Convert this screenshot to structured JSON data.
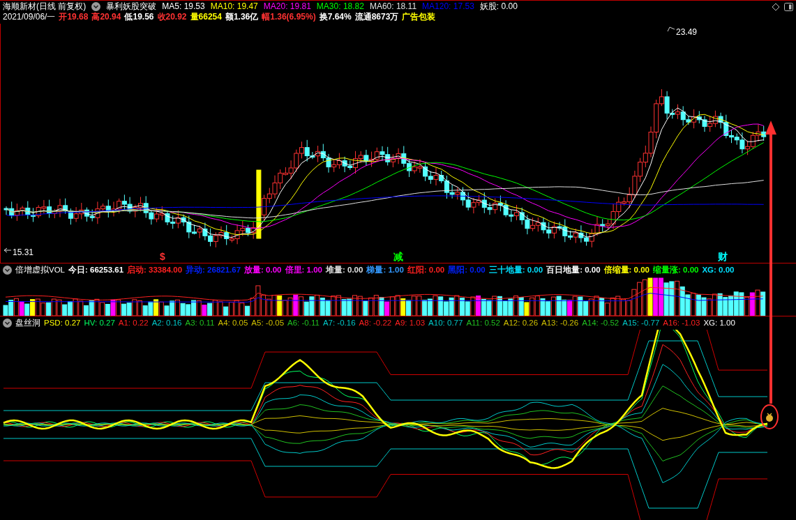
{
  "header": {
    "stock": "海顺新材(日线 前复权)",
    "formula": "暴利妖股突破",
    "ma": [
      {
        "label": "MA5:",
        "value": "19.53",
        "color": "#ffffff"
      },
      {
        "label": "MA10:",
        "value": "19.47",
        "color": "#ffff00"
      },
      {
        "label": "MA20:",
        "value": "19.81",
        "color": "#ff00ff"
      },
      {
        "label": "MA30:",
        "value": "18.82",
        "color": "#00ff00"
      },
      {
        "label": "MA60:",
        "value": "18.11",
        "color": "#e0e0e0"
      },
      {
        "label": "MA120:",
        "value": "17.53",
        "color": "#0000ff"
      },
      {
        "label": "妖股:",
        "value": "0.00",
        "color": "#ffffff"
      }
    ],
    "date": "2021/09/06/一",
    "quote": [
      {
        "text": "开19.68",
        "color": "#ff3232"
      },
      {
        "text": "高20.94",
        "color": "#ff3232"
      },
      {
        "text": "低19.56",
        "color": "#ffffff"
      },
      {
        "text": "收20.92",
        "color": "#ff3232"
      },
      {
        "text": "量66254",
        "color": "#ffff00"
      },
      {
        "text": "额1.36亿",
        "color": "#ffffff"
      },
      {
        "text": "幅1.36(6.95%)",
        "color": "#ff3232"
      },
      {
        "text": "换7.64%",
        "color": "#ffffff"
      },
      {
        "text": "流通8673万",
        "color": "#ffffff"
      },
      {
        "text": "广告包装",
        "color": "#ffff00"
      }
    ]
  },
  "price_chart": {
    "high_label": "23.49",
    "low_label": "15.31",
    "markers": [
      {
        "text": "$",
        "color": "#ff3232"
      },
      {
        "text": "减",
        "color": "#00ff00"
      },
      {
        "text": "财",
        "color": "#00ffff"
      }
    ]
  },
  "volume_panel": {
    "title": "倍增虚拟VOL",
    "items": [
      {
        "label": "今日:",
        "value": "66253.61",
        "color": "#ffffff"
      },
      {
        "label": "启动:",
        "value": "33384.00",
        "color": "#ff2020"
      },
      {
        "label": "异动:",
        "value": "26821.67",
        "color": "#0020ff"
      },
      {
        "label": "放量:",
        "value": "0.00",
        "color": "#ff00ff"
      },
      {
        "label": "倍里:",
        "value": "1.00",
        "color": "#ff00ff"
      },
      {
        "label": "堆量:",
        "value": "0.00",
        "color": "#e0e0e0"
      },
      {
        "label": "梯量:",
        "value": "1.00",
        "color": "#3399ff"
      },
      {
        "label": "红阳:",
        "value": "0.00",
        "color": "#ff2020"
      },
      {
        "label": "黑阳:",
        "value": "0.00",
        "color": "#0020ff"
      },
      {
        "label": "三十地量:",
        "value": "0.00",
        "color": "#00e0ff"
      },
      {
        "label": "百日地量:",
        "value": "0.00",
        "color": "#ffffff"
      },
      {
        "label": "倍缩量:",
        "value": "0.00",
        "color": "#ffff00"
      },
      {
        "label": "缩量涨:",
        "value": "0.00",
        "color": "#00ff00"
      },
      {
        "label": "XG:",
        "value": "0.00",
        "color": "#00e0ff"
      }
    ]
  },
  "oscillator_panel": {
    "title": "盘丝洞",
    "items": [
      {
        "label": "PSD:",
        "value": "0.27",
        "color": "#ffff00"
      },
      {
        "label": "HV:",
        "value": "0.27",
        "color": "#00ff60"
      },
      {
        "label": "A1:",
        "value": "0.22",
        "color": "#ff2020"
      },
      {
        "label": "A2:",
        "value": "0.16",
        "color": "#00c8c8"
      },
      {
        "label": "A3:",
        "value": "0.11",
        "color": "#20c020"
      },
      {
        "label": "A4:",
        "value": "0.05",
        "color": "#d0c000"
      },
      {
        "label": "A5:",
        "value": "-0.05",
        "color": "#d0c000"
      },
      {
        "label": "A6:",
        "value": "-0.11",
        "color": "#20c020"
      },
      {
        "label": "A7:",
        "value": "-0.16",
        "color": "#00c8c8"
      },
      {
        "label": "A8:",
        "value": "-0.22",
        "color": "#ff2020"
      },
      {
        "label": "A9:",
        "value": "1.03",
        "color": "#ff2020"
      },
      {
        "label": "A10:",
        "value": "0.77",
        "color": "#00c8c8"
      },
      {
        "label": "A11:",
        "value": "0.52",
        "color": "#20c020"
      },
      {
        "label": "A12:",
        "value": "0.26",
        "color": "#d0c000"
      },
      {
        "label": "A13:",
        "value": "-0.26",
        "color": "#d0c000"
      },
      {
        "label": "A14:",
        "value": "-0.52",
        "color": "#20c020"
      },
      {
        "label": "A15:",
        "value": "-0.77",
        "color": "#00c8c8"
      },
      {
        "label": "A16:",
        "value": "-1.03",
        "color": "#ff2020"
      },
      {
        "label": "XG:",
        "value": "1.00",
        "color": "#ffffff"
      }
    ]
  }
}
